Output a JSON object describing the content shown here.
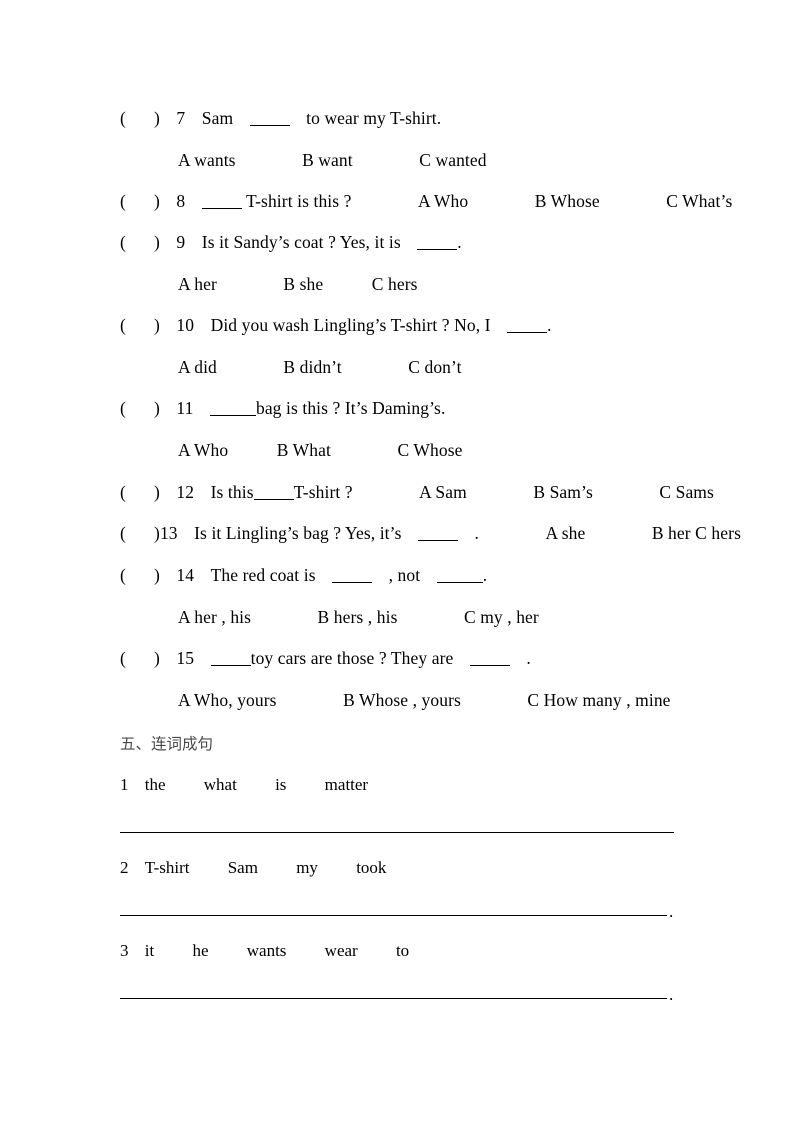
{
  "worksheet": {
    "multiple_choice": {
      "questions": [
        {
          "bracket": "(",
          "close": ")",
          "number": "7",
          "stem_before": "Sam",
          "stem_after": "to wear my T-shirt.",
          "inline_options": [],
          "options": [
            "A wants",
            "B want",
            "C wanted"
          ]
        },
        {
          "bracket": "(",
          "close": ")",
          "number": "8",
          "stem_before": "",
          "stem_after": "T-shirt is this ?",
          "inline_options": [
            "A Who",
            "B Whose",
            "C What’s"
          ],
          "options": []
        },
        {
          "bracket": "(",
          "close": ")",
          "number": "9",
          "stem_before": "Is it Sandy’s coat ? Yes, it is",
          "stem_after": ".",
          "inline_options": [],
          "options": [
            "A her",
            "B she",
            "C hers"
          ]
        },
        {
          "bracket": "(",
          "close": ")",
          "number": "10",
          "stem_before": "Did you wash Lingling’s T-shirt ?   No, I",
          "stem_after": ".",
          "inline_options": [],
          "options": [
            "A did",
            "B didn’t",
            "C don’t"
          ]
        },
        {
          "bracket": "(",
          "close": ")",
          "number": "11",
          "stem_before": "",
          "stem_after": "bag is this ? It’s Daming’s.",
          "inline_options": [],
          "options": [
            "A Who",
            "B What",
            "C Whose"
          ]
        },
        {
          "bracket": "(",
          "close": ")",
          "number": "12",
          "stem_before": "Is this",
          "stem_after": "T-shirt ?",
          "inline_options": [
            "A Sam",
            "B Sam’s",
            "C Sams"
          ],
          "options": []
        },
        {
          "bracket": "(",
          "close": ")",
          "number": "13",
          "stem_before": "Is it Lingling’s bag ? Yes, it’s",
          "stem_after": ".",
          "inline_options": [
            "A she",
            "B her C hers"
          ],
          "options": []
        },
        {
          "bracket": "(",
          "close": ")",
          "number": "14",
          "stem_before": "The red coat is",
          "stem_mid": ", not",
          "stem_after": ".",
          "inline_options": [],
          "options": [
            "A her , his",
            "B hers , his",
            "C my , her"
          ]
        },
        {
          "bracket": "(",
          "close": ")",
          "number": "15",
          "stem_before": "",
          "stem_mid": "toy cars are those ? They are",
          "stem_after": ".",
          "inline_options": [],
          "options": [
            "A Who, yours",
            "B Whose , yours",
            "C How many , mine"
          ]
        }
      ]
    },
    "section_five": {
      "heading": "五、连词成句",
      "items": [
        {
          "number": "1",
          "words": [
            "the",
            "what",
            "is",
            "matter"
          ],
          "end_punctuation": ""
        },
        {
          "number": "2",
          "words": [
            "T-shirt",
            "Sam",
            "my",
            "took"
          ],
          "end_punctuation": "."
        },
        {
          "number": "3",
          "words": [
            "it",
            "he",
            "wants",
            "wear",
            "to"
          ],
          "end_punctuation": "."
        }
      ]
    }
  }
}
